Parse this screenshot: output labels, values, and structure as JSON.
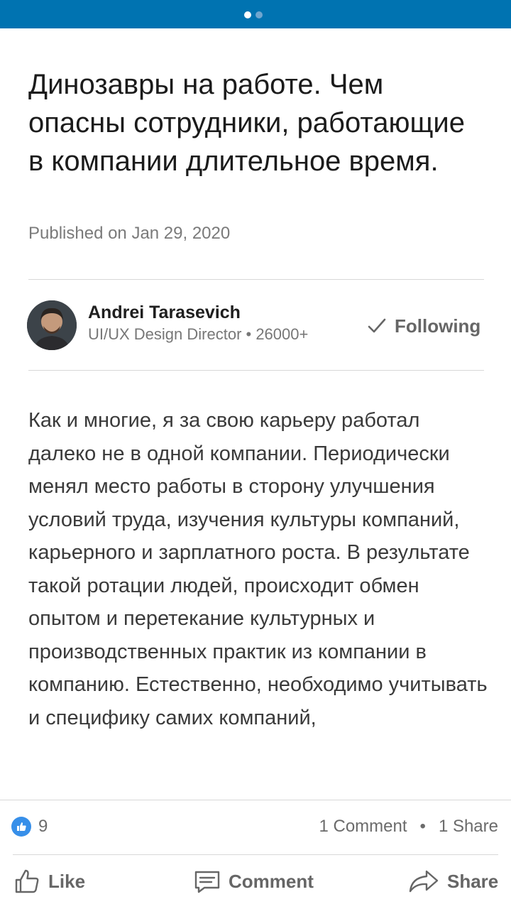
{
  "carousel": {
    "page_count": 2,
    "active_index": 0
  },
  "article": {
    "title": "Динозавры на работе. Чем опасны сотрудники, работающие в компании длительное время.",
    "published": "Published on Jan 29, 2020",
    "body": "Как и многие, я за свою карьеру работал далеко не в одной компании. Периодически менял место работы в сторону улучшения условий труда, изучения культуры компаний, карьерного и зарплатного роста. В результате такой ротации людей, происходит обмен опытом и перетекание культурных и производственных практик из компании в компанию. Естественно, необходимо учитывать и специфику самих компаний,"
  },
  "author": {
    "name": "Andrei Tarasevich",
    "meta": "UI/UX Design Director • 26000+",
    "follow_label": "Following"
  },
  "social": {
    "likes": "9",
    "comments": "1 Comment",
    "separator": "•",
    "shares": "1 Share"
  },
  "actions": {
    "like": "Like",
    "comment": "Comment",
    "share": "Share"
  },
  "colors": {
    "brand": "#0073b1",
    "reaction": "#378fe9",
    "muted_text": "#666666"
  },
  "icons": [
    "thumbs-up-icon",
    "comment-icon",
    "share-icon",
    "checkmark-icon",
    "like-reaction-icon"
  ]
}
